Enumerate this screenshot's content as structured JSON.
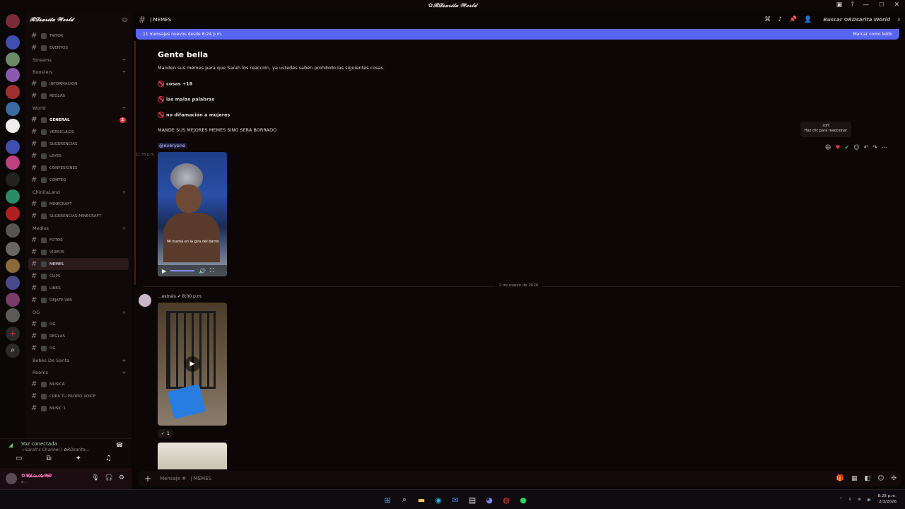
{
  "window": {
    "title": "✿𝓡𝓓𝓼𝓪𝓻𝓲𝓽𝓪 𝓦𝓸𝓻𝓵𝓭"
  },
  "guild": {
    "name": "𝓡𝓓𝓼𝓪𝓻𝓲𝓽𝓪 𝓦𝓸𝓻𝓵𝓭"
  },
  "channels": [
    {
      "kind": "ch",
      "name": "TIKTOK"
    },
    {
      "kind": "ch",
      "name": "EVENTOS"
    },
    {
      "kind": "cat",
      "name": "Streams"
    },
    {
      "kind": "cat",
      "name": "Boosters"
    },
    {
      "kind": "ch",
      "name": "INFORMACION"
    },
    {
      "kind": "ch",
      "name": "REGLAS"
    },
    {
      "kind": "cat",
      "name": "World"
    },
    {
      "kind": "ch",
      "name": "GENERAL",
      "badge": "2",
      "bold": true
    },
    {
      "kind": "ch",
      "name": "VERSICULOS"
    },
    {
      "kind": "ch",
      "name": "SUGERENCIAS"
    },
    {
      "kind": "ch",
      "name": "LEYES"
    },
    {
      "kind": "ch",
      "name": "CONFESIONES"
    },
    {
      "kind": "ch",
      "name": "CONTEO"
    },
    {
      "kind": "cat",
      "name": "ChinitaLand"
    },
    {
      "kind": "ch",
      "name": "MINECRAFT"
    },
    {
      "kind": "ch",
      "name": "SUGERENCIAS-MINECRAFT"
    },
    {
      "kind": "cat",
      "name": "Medios"
    },
    {
      "kind": "ch",
      "name": "FOTOS"
    },
    {
      "kind": "ch",
      "name": "VIDEOS"
    },
    {
      "kind": "ch",
      "name": "MEMES",
      "active": true
    },
    {
      "kind": "ch",
      "name": "CLIPS"
    },
    {
      "kind": "ch",
      "name": "LINKS"
    },
    {
      "kind": "ch",
      "name": "DEJATE-VER"
    },
    {
      "kind": "cat",
      "name": "OG"
    },
    {
      "kind": "ch",
      "name": "OG"
    },
    {
      "kind": "ch",
      "name": "REGLAS"
    },
    {
      "kind": "ch",
      "name": "OG"
    },
    {
      "kind": "cat",
      "name": "Bebes De Sarita"
    },
    {
      "kind": "cat",
      "name": "Rooms"
    },
    {
      "kind": "ch",
      "name": "MUSICA"
    },
    {
      "kind": "ch",
      "name": "CREA TU PROPIO VOICE"
    },
    {
      "kind": "ch",
      "name": "MUSIC 1"
    }
  ],
  "voice": {
    "title": "Voz conectada",
    "sub": "☆Sarah's Channel / ✿RDsarita..."
  },
  "user": {
    "name": "✿𝓒𝓱𝓲𝓷𝓲𝓽𝓪𝟗𝟔𝟎",
    "status": "o..."
  },
  "topbar": {
    "channel": "| MEMES",
    "search": "Buscar ✿RDsarita World"
  },
  "newbar": {
    "text": "11 mensajes nuevos desde 8:24 p.m.",
    "action": "Marcar como leído"
  },
  "message1": {
    "title": "Gente bella",
    "intro": "Manden sus memes para que Sarah los reacción, ya ustedes saben prohibido las siguientes cosas.",
    "rule1": "cosas +18",
    "rule2": "las malas palabras",
    "rule3": "no difamación a mujeres",
    "closing": "MANDE SUS MEJORES MEMES SINO SERA BORRADO",
    "mention": "@everyone",
    "time": "11:35 p.m.",
    "video_caption": "Mi mamá en la gira del barrio"
  },
  "tooltip": {
    "name": ":rofl:",
    "hint": "Haz clic para reaccionar"
  },
  "date_divider": "2 de marzo de 2026",
  "message2": {
    "author": "...estrals",
    "time": "8:00 p.m.",
    "reaction_count": "1"
  },
  "composer": {
    "placeholder": "Mensaje #",
    "channel": "| MEMES"
  },
  "clock": {
    "time": "8:28 p.m.",
    "date": "2/3/2026"
  }
}
